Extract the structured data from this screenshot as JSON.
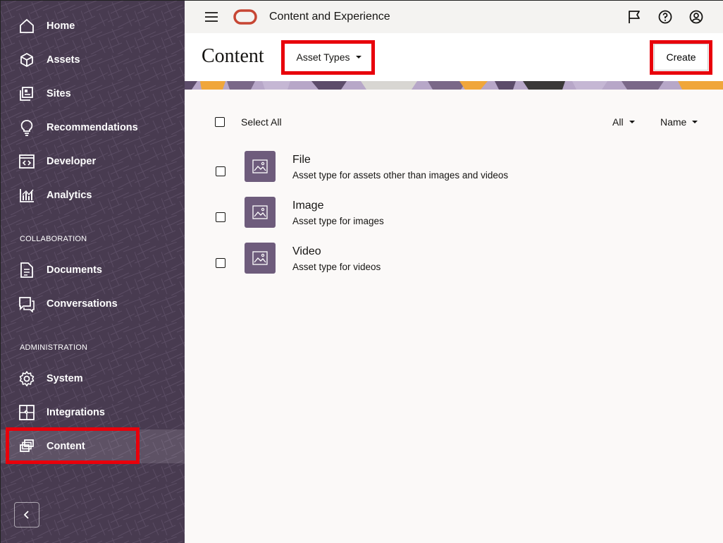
{
  "topbar": {
    "app_title": "Content and Experience"
  },
  "sidebar": {
    "items": [
      {
        "label": "Home"
      },
      {
        "label": "Assets"
      },
      {
        "label": "Sites"
      },
      {
        "label": "Recommendations"
      },
      {
        "label": "Developer"
      },
      {
        "label": "Analytics"
      }
    ],
    "collaboration_label": "COLLABORATION",
    "collaboration_items": [
      {
        "label": "Documents"
      },
      {
        "label": "Conversations"
      }
    ],
    "administration_label": "ADMINISTRATION",
    "administration_items": [
      {
        "label": "System"
      },
      {
        "label": "Integrations"
      },
      {
        "label": "Content"
      }
    ],
    "active_item": "Content"
  },
  "header": {
    "title": "Content",
    "asset_types_label": "Asset Types",
    "create_label": "Create"
  },
  "toolbar": {
    "select_all_label": "Select All",
    "filter_label": "All",
    "sort_label": "Name"
  },
  "asset_types": [
    {
      "name": "File",
      "description": "Asset type for assets other than images and videos"
    },
    {
      "name": "Image",
      "description": "Asset type for images"
    },
    {
      "name": "Video",
      "description": "Asset type for videos"
    }
  ],
  "colors": {
    "sidebar_bg": "#4a3d52",
    "highlight": "#e8000b",
    "brand_red": "#c74634",
    "thumb_bg": "#6e5c7c"
  }
}
